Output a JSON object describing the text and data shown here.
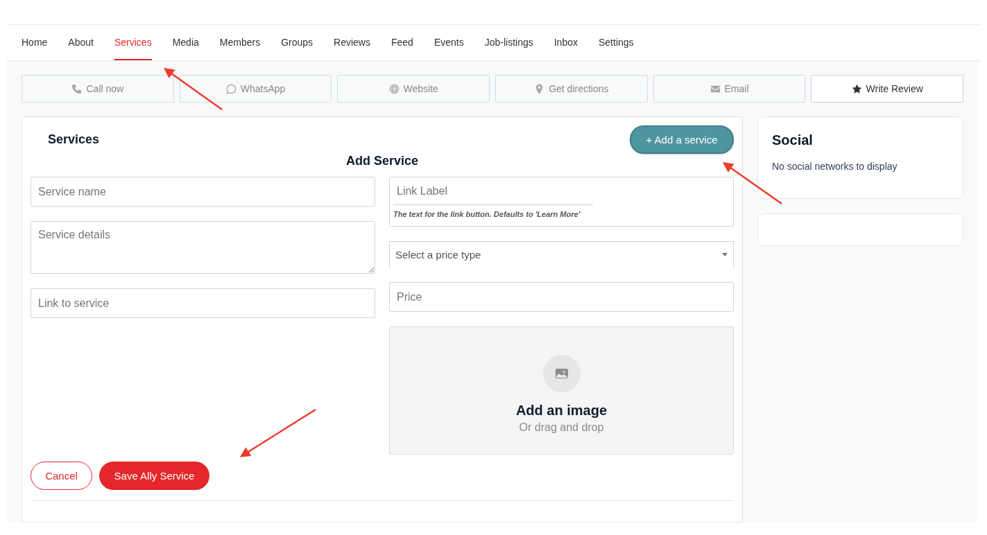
{
  "nav": [
    {
      "label": "Home",
      "selected": false
    },
    {
      "label": "About",
      "selected": false
    },
    {
      "label": "Services",
      "selected": true
    },
    {
      "label": "Media",
      "selected": false
    },
    {
      "label": "Members",
      "selected": false
    },
    {
      "label": "Groups",
      "selected": false
    },
    {
      "label": "Reviews",
      "selected": false
    },
    {
      "label": "Feed",
      "selected": false
    },
    {
      "label": "Events",
      "selected": false
    },
    {
      "label": "Job-listings",
      "selected": false
    },
    {
      "label": "Inbox",
      "selected": false
    },
    {
      "label": "Settings",
      "selected": false
    }
  ],
  "actions": [
    {
      "kind": "phone",
      "label": "Call now",
      "disabled": true
    },
    {
      "kind": "chat",
      "label": "WhatsApp",
      "disabled": true
    },
    {
      "kind": "globe",
      "label": "Website",
      "disabled": true
    },
    {
      "kind": "pin",
      "label": "Get directions",
      "disabled": true
    },
    {
      "kind": "envelope",
      "label": "Email",
      "disabled": true
    },
    {
      "kind": "star",
      "label": "Write Review",
      "disabled": false
    }
  ],
  "services": {
    "title": "Services",
    "add_button": "+ Add a service",
    "form_title": "Add Service",
    "left_fields": [
      {
        "kind": "input",
        "placeholder": "Service name"
      },
      {
        "kind": "textarea",
        "placeholder": "Service details"
      },
      {
        "kind": "input",
        "placeholder": "Link to service"
      }
    ],
    "link_label": {
      "placeholder": "Link Label",
      "hint": "The text for the link button. Defaults to 'Learn More'"
    },
    "price_type": {
      "placeholder": "Select a price type"
    },
    "price": {
      "placeholder": "Price"
    },
    "image_drop": {
      "title": "Add an image",
      "subtitle": "Or drag and drop"
    },
    "cancel_button": "Cancel",
    "save_button": "Save Ally Service"
  },
  "social": {
    "title": "Social",
    "empty_text": "No social networks to display"
  }
}
